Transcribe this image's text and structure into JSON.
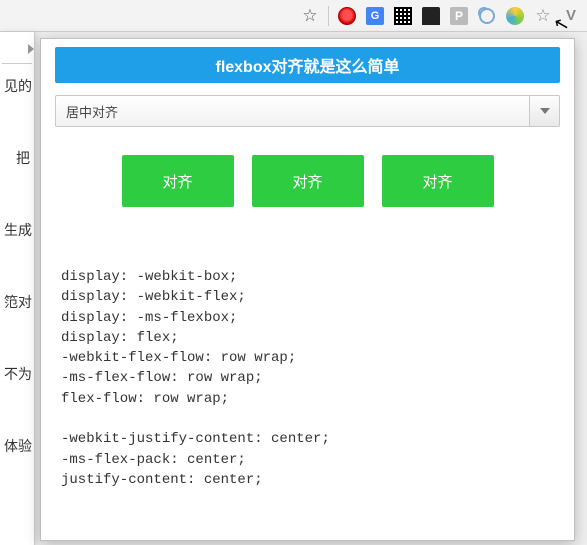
{
  "toolbar": {
    "icons": [
      "star",
      "opera",
      "translate",
      "qr",
      "cat",
      "p",
      "moon",
      "swirl",
      "star-outline",
      "v"
    ]
  },
  "left_fragments": [
    "见的",
    "把",
    "生成",
    "笵对",
    "不为",
    "体验"
  ],
  "panel": {
    "title": "flexbox对齐就是这么简单",
    "select_value": "居中对齐",
    "buttons": [
      "对齐",
      "对齐",
      "对齐"
    ],
    "code": "display: -webkit-box;\ndisplay: -webkit-flex;\ndisplay: -ms-flexbox;\ndisplay: flex;\n-webkit-flex-flow: row wrap;\n-ms-flex-flow: row wrap;\nflex-flow: row wrap;\n\n-webkit-justify-content: center;\n-ms-flex-pack: center;\njustify-content: center;"
  }
}
